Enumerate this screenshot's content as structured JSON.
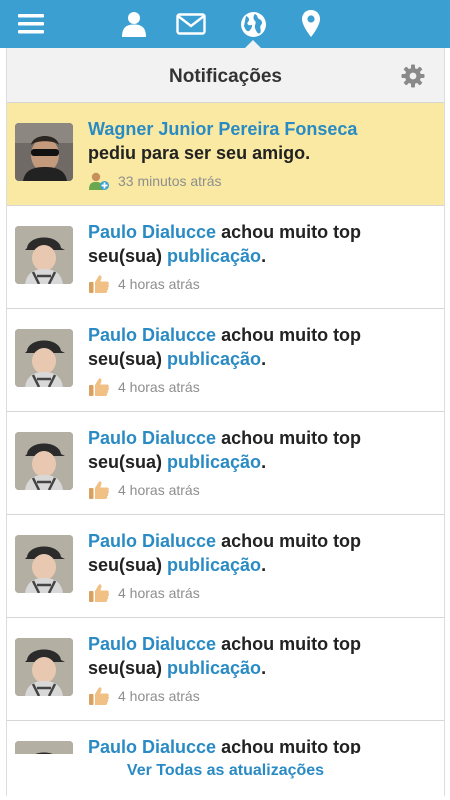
{
  "nav": {
    "items": [
      {
        "icon": "menu-icon"
      },
      {
        "icon": "user-icon"
      },
      {
        "icon": "mail-icon"
      },
      {
        "icon": "globe-icon",
        "active": true
      },
      {
        "icon": "map-pin-icon"
      }
    ],
    "color": "#3b9fd1"
  },
  "header": {
    "title": "Notificações",
    "settings_icon": "gear-icon"
  },
  "notifications": [
    {
      "name": "Wagner Junior Pereira Fonseca",
      "action": "pediu para ser seu amigo.",
      "time": "33 minutos atrás",
      "type": "friend-request",
      "highlighted": true
    },
    {
      "name": "Paulo Dialucce",
      "action": " achou muito top seu(sua) ",
      "link": "publicação",
      "end": ".",
      "time": "4 horas atrás",
      "type": "like"
    },
    {
      "name": "Paulo Dialucce",
      "action": " achou muito top seu(sua) ",
      "link": "publicação",
      "end": ".",
      "time": "4 horas atrás",
      "type": "like"
    },
    {
      "name": "Paulo Dialucce",
      "action": " achou muito top seu(sua) ",
      "link": "publicação",
      "end": ".",
      "time": "4 horas atrás",
      "type": "like"
    },
    {
      "name": "Paulo Dialucce",
      "action": " achou muito top seu(sua) ",
      "link": "publicação",
      "end": ".",
      "time": "4 horas atrás",
      "type": "like"
    },
    {
      "name": "Paulo Dialucce",
      "action": " achou muito top seu(sua) ",
      "link": "publicação",
      "end": ".",
      "time": "4 horas atrás",
      "type": "like"
    },
    {
      "name": "Paulo Dialucce",
      "action": " achou muito top",
      "link": "",
      "end": "",
      "time": "",
      "type": "like"
    }
  ],
  "footer": {
    "see_all": "Ver Todas as atualizações"
  }
}
